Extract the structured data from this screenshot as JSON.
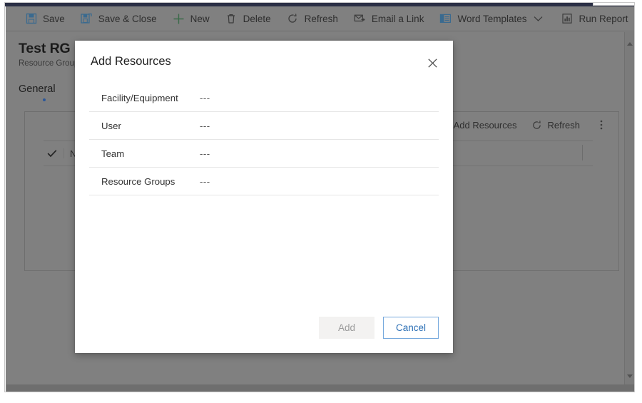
{
  "command_bar": {
    "buttons": [
      {
        "label": "Save",
        "icon": "save-icon",
        "caret": false
      },
      {
        "label": "Save & Close",
        "icon": "save-and-close-icon",
        "caret": false
      },
      {
        "label": "New",
        "icon": "plus-icon",
        "caret": false
      },
      {
        "label": "Delete",
        "icon": "trash-icon",
        "caret": false
      },
      {
        "label": "Email a Link",
        "icon": "email-link-icon",
        "caret": false
      },
      {
        "label": "Word Templates",
        "icon": "word-template-icon",
        "caret": true
      },
      {
        "label": "Run Report",
        "icon": "report-icon",
        "caret": true
      }
    ]
  },
  "record": {
    "title": "Test RG",
    "subtitle": "Resource Groups"
  },
  "tabs": [
    {
      "label": "General",
      "selected": true
    }
  ],
  "subgrid": {
    "toolbar": [
      {
        "label": "Add Resources",
        "icon": "plus-icon"
      },
      {
        "label": "Refresh",
        "icon": "refresh-icon"
      },
      {
        "label": "",
        "icon": "overflow-menu-icon"
      }
    ],
    "columns": [
      {
        "label": "Name",
        "sortable": true
      }
    ],
    "select_all_icon": "checkmark-icon"
  },
  "dialog": {
    "title": "Add Resources",
    "close_icon": "close-icon",
    "fields": [
      {
        "label": "Facility/Equipment",
        "value": "---"
      },
      {
        "label": "User",
        "value": "---"
      },
      {
        "label": "Team",
        "value": "---"
      },
      {
        "label": "Resource Groups",
        "value": "---"
      }
    ],
    "primary_button": "Add",
    "secondary_button": "Cancel"
  },
  "colors": {
    "accent": "#2b6fb5",
    "cancel_border": "#76a9dd",
    "tab_indicator": "#2b579a",
    "scrim": "#808080",
    "title_bar": "#2b2f45"
  }
}
